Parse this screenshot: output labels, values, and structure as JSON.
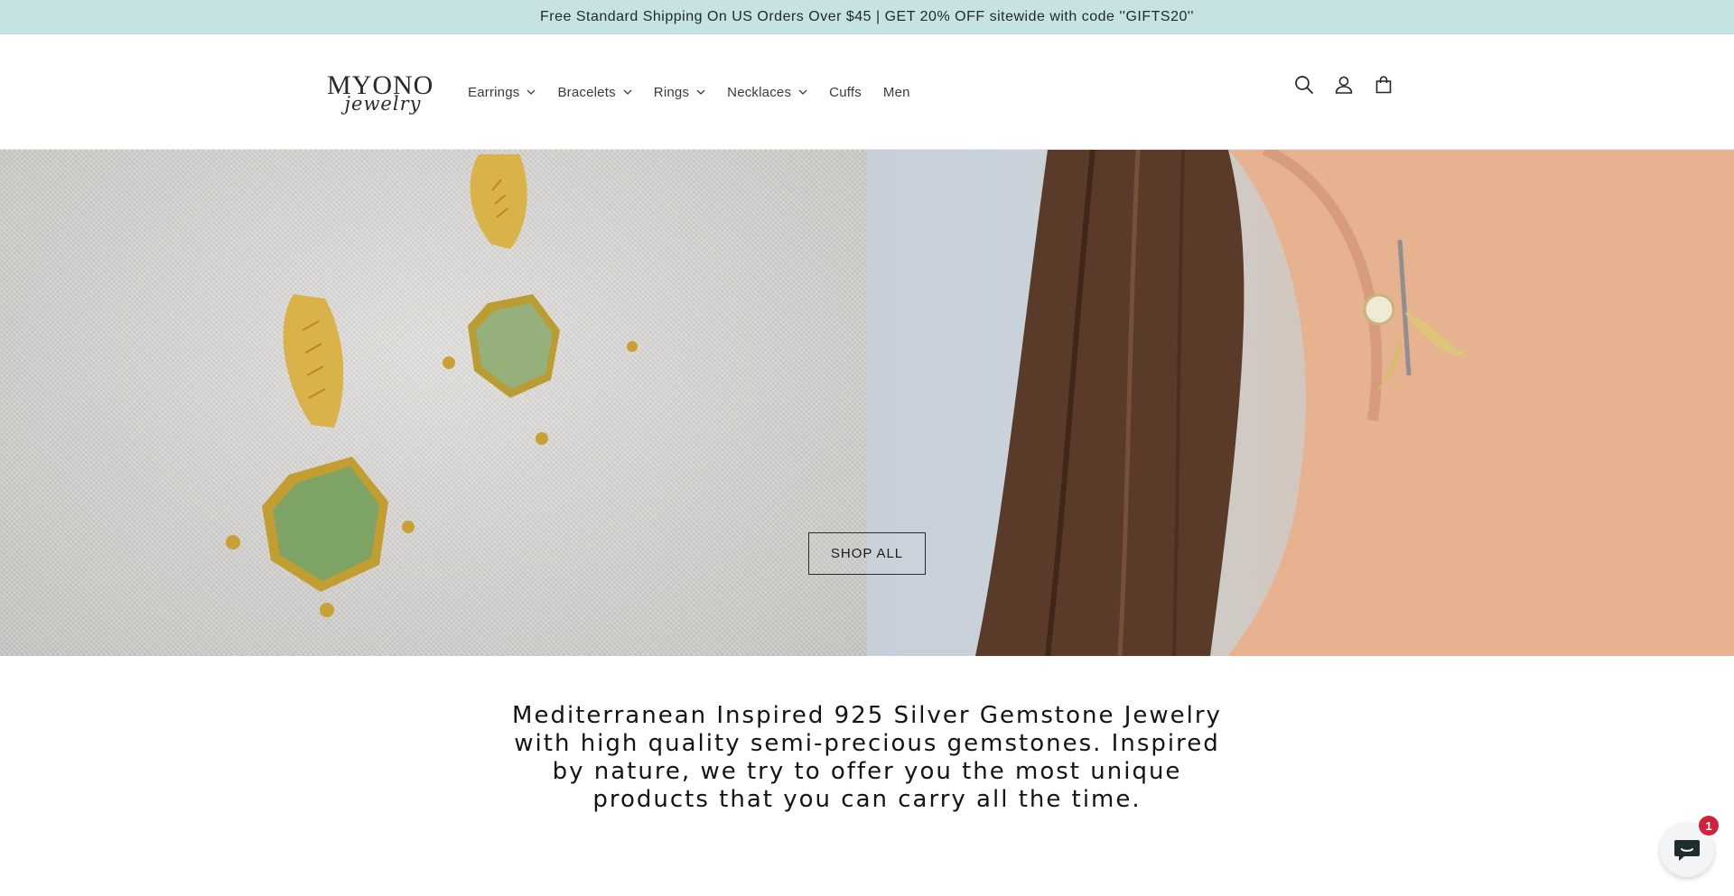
{
  "announcement": {
    "text": "Free Standard Shipping On US Orders Over $45 | GET 20% OFF sitewide with code ''GIFTS20''"
  },
  "logo": {
    "main": "MYONO",
    "script": "jewelry"
  },
  "nav": {
    "items": [
      {
        "label": "Earrings",
        "has_dropdown": true
      },
      {
        "label": "Bracelets",
        "has_dropdown": true
      },
      {
        "label": "Rings",
        "has_dropdown": true
      },
      {
        "label": "Necklaces",
        "has_dropdown": true
      },
      {
        "label": "Cuffs",
        "has_dropdown": false
      },
      {
        "label": "Men",
        "has_dropdown": false
      }
    ]
  },
  "header_icons": [
    "search-icon",
    "account-icon",
    "cart-icon"
  ],
  "hero": {
    "button_label": "SHOP ALL"
  },
  "tagline": "Mediterranean Inspired 925 Silver Gemstone Jewelry with high quality semi-precious gemstones. Inspired by nature, we try to offer you the most unique products that you can carry all the time.",
  "chat": {
    "badge_count": "1"
  },
  "colors": {
    "announcement_bg": "#c6e2e3",
    "text": "#222222",
    "chat_badge": "#d3213b"
  }
}
